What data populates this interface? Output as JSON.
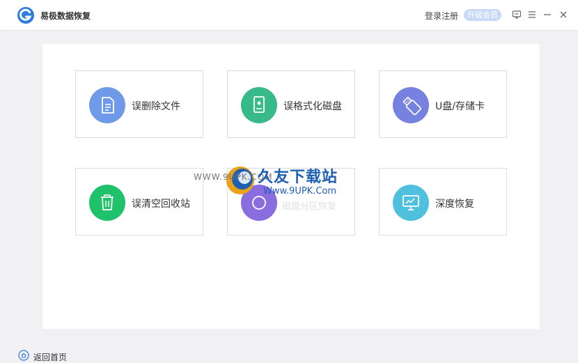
{
  "titlebar": {
    "app_title": "易极数据恢复",
    "login": "登录注册",
    "upgrade": "升级会员"
  },
  "cards": [
    {
      "label": "误删除文件",
      "icon": "document-icon",
      "color": "#6f9ae8"
    },
    {
      "label": "误格式化磁盘",
      "icon": "disk-icon",
      "color": "#38b98a"
    },
    {
      "label": "U盘/存储卡",
      "icon": "usb-drive-icon",
      "color": "#7781e0"
    },
    {
      "label": "误清空回收站",
      "icon": "trash-icon",
      "color": "#1fc16b"
    },
    {
      "label": "",
      "icon": "partition-icon",
      "color": "#8a6ee0"
    },
    {
      "label": "深度恢复",
      "icon": "monitor-icon",
      "color": "#4fc1df"
    }
  ],
  "watermark": {
    "small": "WWW.9UPK.COM",
    "big": "久友下载站",
    "url": "Www.9UPK.Com",
    "faded": "磁盘分区恢复"
  },
  "footer": {
    "back_home": "返回首页"
  },
  "colors": {
    "accent": "#2f7be0",
    "upgrade_badge": "#c9daf6"
  }
}
